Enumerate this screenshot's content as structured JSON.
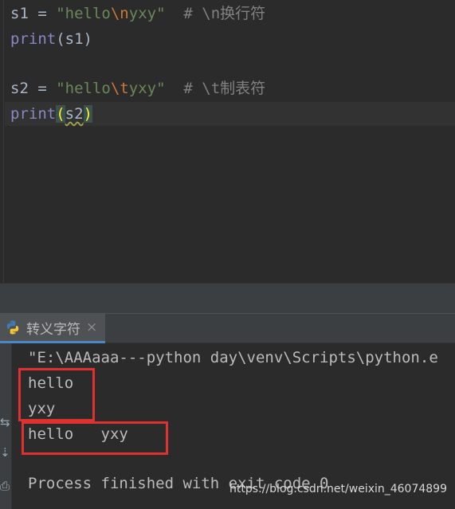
{
  "editor": {
    "lines": [
      {
        "var": "s1",
        "eq": " = ",
        "str_open": "\"hello",
        "escape": "\\n",
        "str_close": "yxy\"",
        "comment": "  # \\n换行符"
      },
      {
        "fn": "print",
        "args": "(s1)"
      },
      {
        "var": "s2",
        "eq": " = ",
        "str_open": "\"hello",
        "escape": "\\t",
        "str_close": "yxy\"",
        "comment": "  # \\t制表符"
      },
      {
        "fn": "print",
        "paren_open": "(",
        "arg": "s2",
        "paren_close": ")"
      }
    ]
  },
  "run_panel": {
    "tab_label": "转义字符",
    "tab_close": "×",
    "icon": "python-icon"
  },
  "console": {
    "lines": [
      "\"E:\\AAAaaa---python day\\venv\\Scripts\\python.e",
      "hello",
      "yxy",
      "hello\tyxy",
      "",
      "Process finished with exit code 0"
    ],
    "toolbar_icons": [
      "rerun-icon",
      "stop-icon",
      "wrap-icon",
      "pin-icon"
    ]
  },
  "watermark": "https://blog.csdn.net/weixin_46074899",
  "colors": {
    "background": "#2b2b2b",
    "string": "#6a8759",
    "escape": "#cc7832",
    "comment": "#808080",
    "builtin": "#8888c6",
    "annotation_box": "#e03131"
  }
}
